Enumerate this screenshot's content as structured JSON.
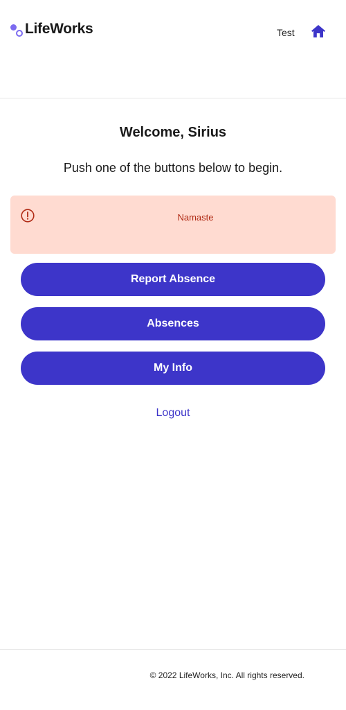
{
  "header": {
    "logo_text": "LifeWorks",
    "user_label": "Test",
    "home_icon": "home-icon"
  },
  "main": {
    "welcome": "Welcome, Sirius",
    "subtitle": "Push one of the buttons below to begin.",
    "alert": {
      "icon": "alert-circle-icon",
      "message": "Namaste"
    },
    "buttons": [
      {
        "label": "Report Absence"
      },
      {
        "label": "Absences"
      },
      {
        "label": "My Info"
      }
    ],
    "logout_label": "Logout"
  },
  "footer": {
    "copyright": "© 2022 LifeWorks, Inc. All rights reserved."
  },
  "colors": {
    "primary": "#3d35c9",
    "logo_accent": "#7c6bf0",
    "alert_bg": "#ffdbd1",
    "alert_text": "#b02a14"
  }
}
